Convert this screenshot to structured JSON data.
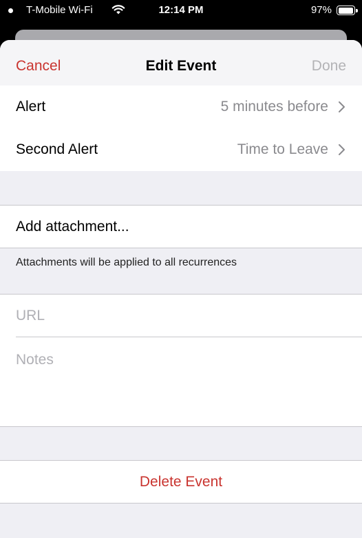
{
  "status_bar": {
    "carrier": "T-Mobile Wi-Fi",
    "time": "12:14 PM",
    "battery": "97%"
  },
  "nav": {
    "cancel_label": "Cancel",
    "title": "Edit Event",
    "done_label": "Done"
  },
  "alerts": {
    "alert_label": "Alert",
    "alert_value": "5 minutes before",
    "second_alert_label": "Second Alert",
    "second_alert_value": "Time to Leave"
  },
  "attachment": {
    "add_label": "Add attachment...",
    "footnote": "Attachments will be applied to all recurrences"
  },
  "fields": {
    "url_placeholder": "URL",
    "notes_placeholder": "Notes"
  },
  "delete_label": "Delete Event",
  "colors": {
    "accent": "#c9342f",
    "disabled": "#b3b3b6",
    "secondary_text": "#8a8a8e",
    "group_background": "#efeff4"
  }
}
